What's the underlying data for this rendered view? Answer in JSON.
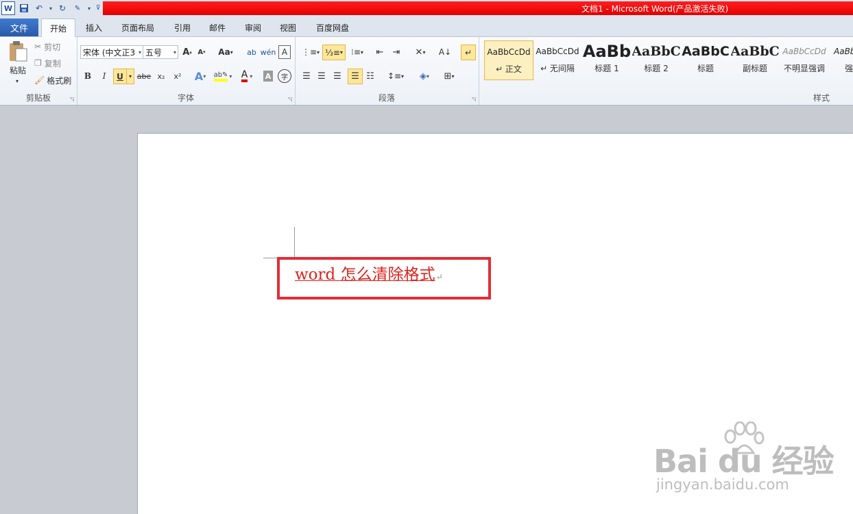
{
  "window": {
    "title": "文档1 - Microsoft Word(产品激活失败)"
  },
  "colors": {
    "title_bar": "#e80000",
    "file_tab": "#2f64b6",
    "highlight": "#fde79a",
    "doc_text": "#e0211b",
    "annotation_box": "#e22d36"
  },
  "quick_access": [
    "word-logo-icon",
    "save-icon",
    "undo-icon",
    "redo-icon",
    "spellcheck-icon",
    "customize-icon"
  ],
  "tabs": {
    "file": "文件",
    "items": [
      "开始",
      "插入",
      "页面布局",
      "引用",
      "邮件",
      "审阅",
      "视图",
      "百度网盘"
    ]
  },
  "clipboard": {
    "label": "剪贴板",
    "paste": "粘贴",
    "cut": "剪切",
    "copy": "复制",
    "format_painter": "格式刷"
  },
  "font": {
    "label": "字体",
    "name": "宋体 (中文正3",
    "size": "五号",
    "bold": "B",
    "italic": "I",
    "underline": "U",
    "strike": "abe",
    "sub": "x₂",
    "sup": "x²",
    "change_case": "Aa",
    "grow": "A",
    "shrink": "A",
    "font_color": "A",
    "char_shading": "A",
    "enclose": "字"
  },
  "paragraph": {
    "label": "段落"
  },
  "styles": {
    "label": "样式",
    "items": [
      {
        "sample": "AaBbCcDd",
        "name": "↵ 正文"
      },
      {
        "sample": "AaBbCcDd",
        "name": "↵ 无间隔"
      },
      {
        "sample": "AaBb",
        "name": "标题 1"
      },
      {
        "sample": "AaBbC",
        "name": "标题 2"
      },
      {
        "sample": "AaBbC",
        "name": "标题"
      },
      {
        "sample": "AaBbC",
        "name": "副标题"
      },
      {
        "sample": "AaBbCcDd",
        "name": "不明显强调"
      },
      {
        "sample": "AaBb",
        "name": "强"
      }
    ]
  },
  "document": {
    "text": "word 怎么清除格式",
    "paragraph_mark": "↵"
  },
  "watermark": {
    "logo": "Bai du 经验",
    "url": "jingyan.baidu.com"
  }
}
